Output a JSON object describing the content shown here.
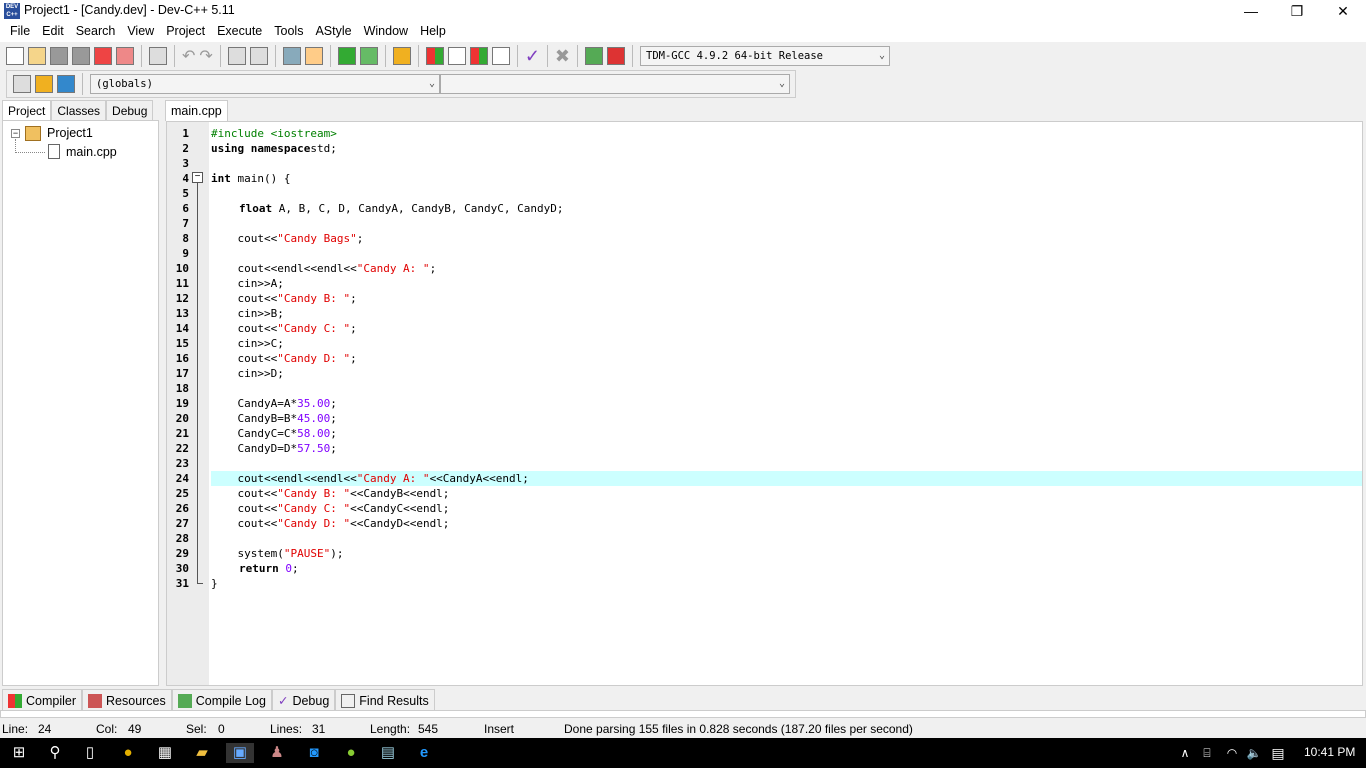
{
  "window": {
    "title": "Project1 - [Candy.dev] - Dev-C++ 5.11",
    "minimize": "—",
    "maximize": "❐",
    "close": "✕"
  },
  "menu": [
    "File",
    "Edit",
    "Search",
    "View",
    "Project",
    "Execute",
    "Tools",
    "AStyle",
    "Window",
    "Help"
  ],
  "toolbar": {
    "compiler_select": "TDM-GCC 4.9.2 64-bit Release",
    "scope_select": "(globals)",
    "member_select": ""
  },
  "left_tabs": [
    "Project",
    "Classes",
    "Debug"
  ],
  "tree": {
    "project": "Project1",
    "file": "main.cpp"
  },
  "editor_tab": "main.cpp",
  "current_line": 24,
  "code": [
    [
      [
        "pp",
        "#include <iostream>"
      ]
    ],
    [
      [
        "kw",
        "using namespace"
      ],
      [
        "",
        "std;"
      ]
    ],
    [],
    [
      [
        "kw",
        "int"
      ],
      [
        "",
        " main() {"
      ]
    ],
    [],
    [
      [
        "",
        " "
      ],
      [
        "kw",
        "float"
      ],
      [
        "",
        " A, B, C, D, CandyA, CandyB, CandyC, CandyD;"
      ]
    ],
    [],
    [
      [
        "",
        "    cout<<"
      ],
      [
        "str",
        "\"Candy Bags\""
      ],
      [
        "",
        ";"
      ]
    ],
    [],
    [
      [
        "",
        "    cout<<endl<<endl<<"
      ],
      [
        "str",
        "\"Candy A: \""
      ],
      [
        "",
        ";"
      ]
    ],
    [
      [
        "",
        "    cin>>A;"
      ]
    ],
    [
      [
        "",
        "    cout<<"
      ],
      [
        "str",
        "\"Candy B: \""
      ],
      [
        "",
        ";"
      ]
    ],
    [
      [
        "",
        "    cin>>B;"
      ]
    ],
    [
      [
        "",
        "    cout<<"
      ],
      [
        "str",
        "\"Candy C: \""
      ],
      [
        "",
        ";"
      ]
    ],
    [
      [
        "",
        "    cin>>C;"
      ]
    ],
    [
      [
        "",
        "    cout<<"
      ],
      [
        "str",
        "\"Candy D: \""
      ],
      [
        "",
        ";"
      ]
    ],
    [
      [
        "",
        "    cin>>D;"
      ]
    ],
    [],
    [
      [
        "",
        "    CandyA=A*"
      ],
      [
        "num",
        "35.00"
      ],
      [
        "",
        ";"
      ]
    ],
    [
      [
        "",
        "    CandyB=B*"
      ],
      [
        "num",
        "45.00"
      ],
      [
        "",
        ";"
      ]
    ],
    [
      [
        "",
        "    CandyC=C*"
      ],
      [
        "num",
        "58.00"
      ],
      [
        "",
        ";"
      ]
    ],
    [
      [
        "",
        "    CandyD=D*"
      ],
      [
        "num",
        "57.50"
      ],
      [
        "",
        ";"
      ]
    ],
    [],
    [
      [
        "",
        "    cout<<endl<<endl<<"
      ],
      [
        "str",
        "\"Candy A: \""
      ],
      [
        "",
        "<<CandyA<<endl;"
      ]
    ],
    [
      [
        "",
        "    cout<<"
      ],
      [
        "str",
        "\"Candy B: \""
      ],
      [
        "",
        "<<CandyB<<endl;"
      ]
    ],
    [
      [
        "",
        "    cout<<"
      ],
      [
        "str",
        "\"Candy C: \""
      ],
      [
        "",
        "<<CandyC<<endl;"
      ]
    ],
    [
      [
        "",
        "    cout<<"
      ],
      [
        "str",
        "\"Candy D: \""
      ],
      [
        "",
        "<<CandyD<<endl;"
      ]
    ],
    [],
    [
      [
        "",
        "    system("
      ],
      [
        "str",
        "\"PAUSE\""
      ],
      [
        "",
        ");"
      ]
    ],
    [
      [
        "    ",
        ""
      ],
      [
        "kw",
        "return"
      ],
      [
        "",
        " "
      ],
      [
        "num",
        "0"
      ],
      [
        "",
        ";"
      ]
    ],
    [
      [
        "",
        "}"
      ]
    ]
  ],
  "bottom_tabs": [
    "Compiler",
    "Resources",
    "Compile Log",
    "Debug",
    "Find Results"
  ],
  "status": {
    "line_label": "Line:",
    "line": "24",
    "col_label": "Col:",
    "col": "49",
    "sel_label": "Sel:",
    "sel": "0",
    "lines_label": "Lines:",
    "lines": "31",
    "length_label": "Length:",
    "length": "545",
    "mode": "Insert",
    "message": "Done parsing 155 files in 0.828 seconds (187.20 files per second)"
  },
  "taskbar": {
    "clock": "10:41 PM"
  }
}
